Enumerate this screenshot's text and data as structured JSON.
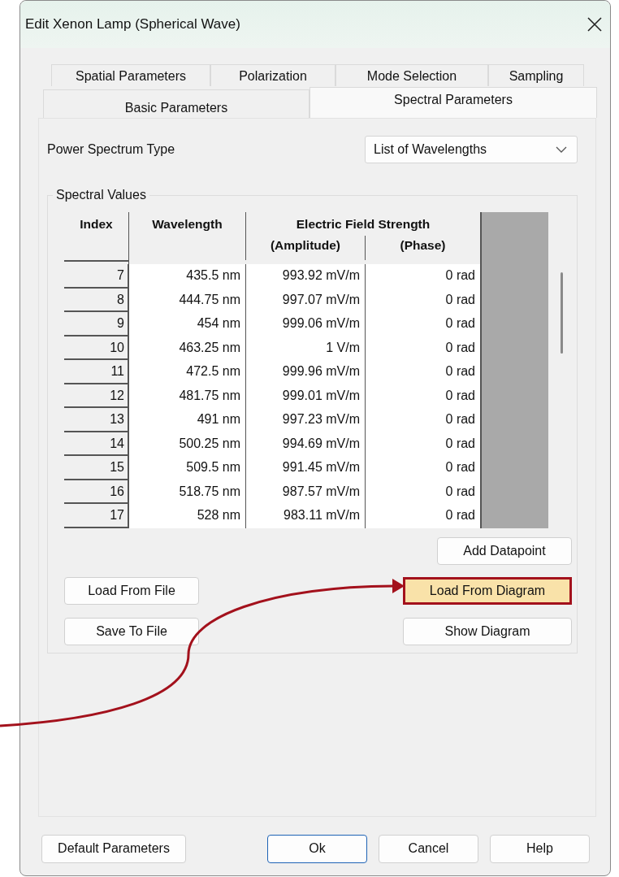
{
  "window": {
    "title": "Edit Xenon Lamp (Spherical Wave)"
  },
  "tab_rows": [
    [
      {
        "label": "Spatial Parameters",
        "selected": false
      },
      {
        "label": "Polarization",
        "selected": false
      },
      {
        "label": "Mode Selection",
        "selected": false
      },
      {
        "label": "Sampling",
        "selected": false
      }
    ],
    [
      {
        "label": "Basic Parameters",
        "selected": false
      },
      {
        "label": "Spectral Parameters",
        "selected": true
      }
    ]
  ],
  "power_spectrum_type": {
    "label": "Power Spectrum Type",
    "value": "List of Wavelengths"
  },
  "spectral_values": {
    "title": "Spectral Values",
    "columns": {
      "index": "Index",
      "wavelength": "Wavelength",
      "group": "Electric Field Strength",
      "amplitude": "(Amplitude)",
      "phase": "(Phase)"
    },
    "rows": [
      {
        "index": "7",
        "wavelength": "435.5 nm",
        "amplitude": "993.92 mV/m",
        "phase": "0 rad"
      },
      {
        "index": "8",
        "wavelength": "444.75 nm",
        "amplitude": "997.07 mV/m",
        "phase": "0 rad"
      },
      {
        "index": "9",
        "wavelength": "454 nm",
        "amplitude": "999.06 mV/m",
        "phase": "0 rad"
      },
      {
        "index": "10",
        "wavelength": "463.25 nm",
        "amplitude": "1 V/m",
        "phase": "0 rad"
      },
      {
        "index": "11",
        "wavelength": "472.5 nm",
        "amplitude": "999.96 mV/m",
        "phase": "0 rad"
      },
      {
        "index": "12",
        "wavelength": "481.75 nm",
        "amplitude": "999.01 mV/m",
        "phase": "0 rad"
      },
      {
        "index": "13",
        "wavelength": "491 nm",
        "amplitude": "997.23 mV/m",
        "phase": "0 rad"
      },
      {
        "index": "14",
        "wavelength": "500.25 nm",
        "amplitude": "994.69 mV/m",
        "phase": "0 rad"
      },
      {
        "index": "15",
        "wavelength": "509.5 nm",
        "amplitude": "991.45 mV/m",
        "phase": "0 rad"
      },
      {
        "index": "16",
        "wavelength": "518.75 nm",
        "amplitude": "987.57 mV/m",
        "phase": "0 rad"
      },
      {
        "index": "17",
        "wavelength": "528 nm",
        "amplitude": "983.11 mV/m",
        "phase": "0 rad"
      }
    ],
    "add_button": "Add Datapoint",
    "load_file_button": "Load From File",
    "save_file_button": "Save To File",
    "load_diagram_button": {
      "label": "Load From Diagram",
      "highlighted": true
    },
    "show_diagram_button": "Show Diagram"
  },
  "footer_buttons": [
    {
      "label": "Default Parameters",
      "kind": "left"
    },
    {
      "label": "Ok",
      "kind": "default"
    },
    {
      "label": "Cancel",
      "kind": "normal"
    },
    {
      "label": "Help",
      "kind": "normal"
    }
  ]
}
